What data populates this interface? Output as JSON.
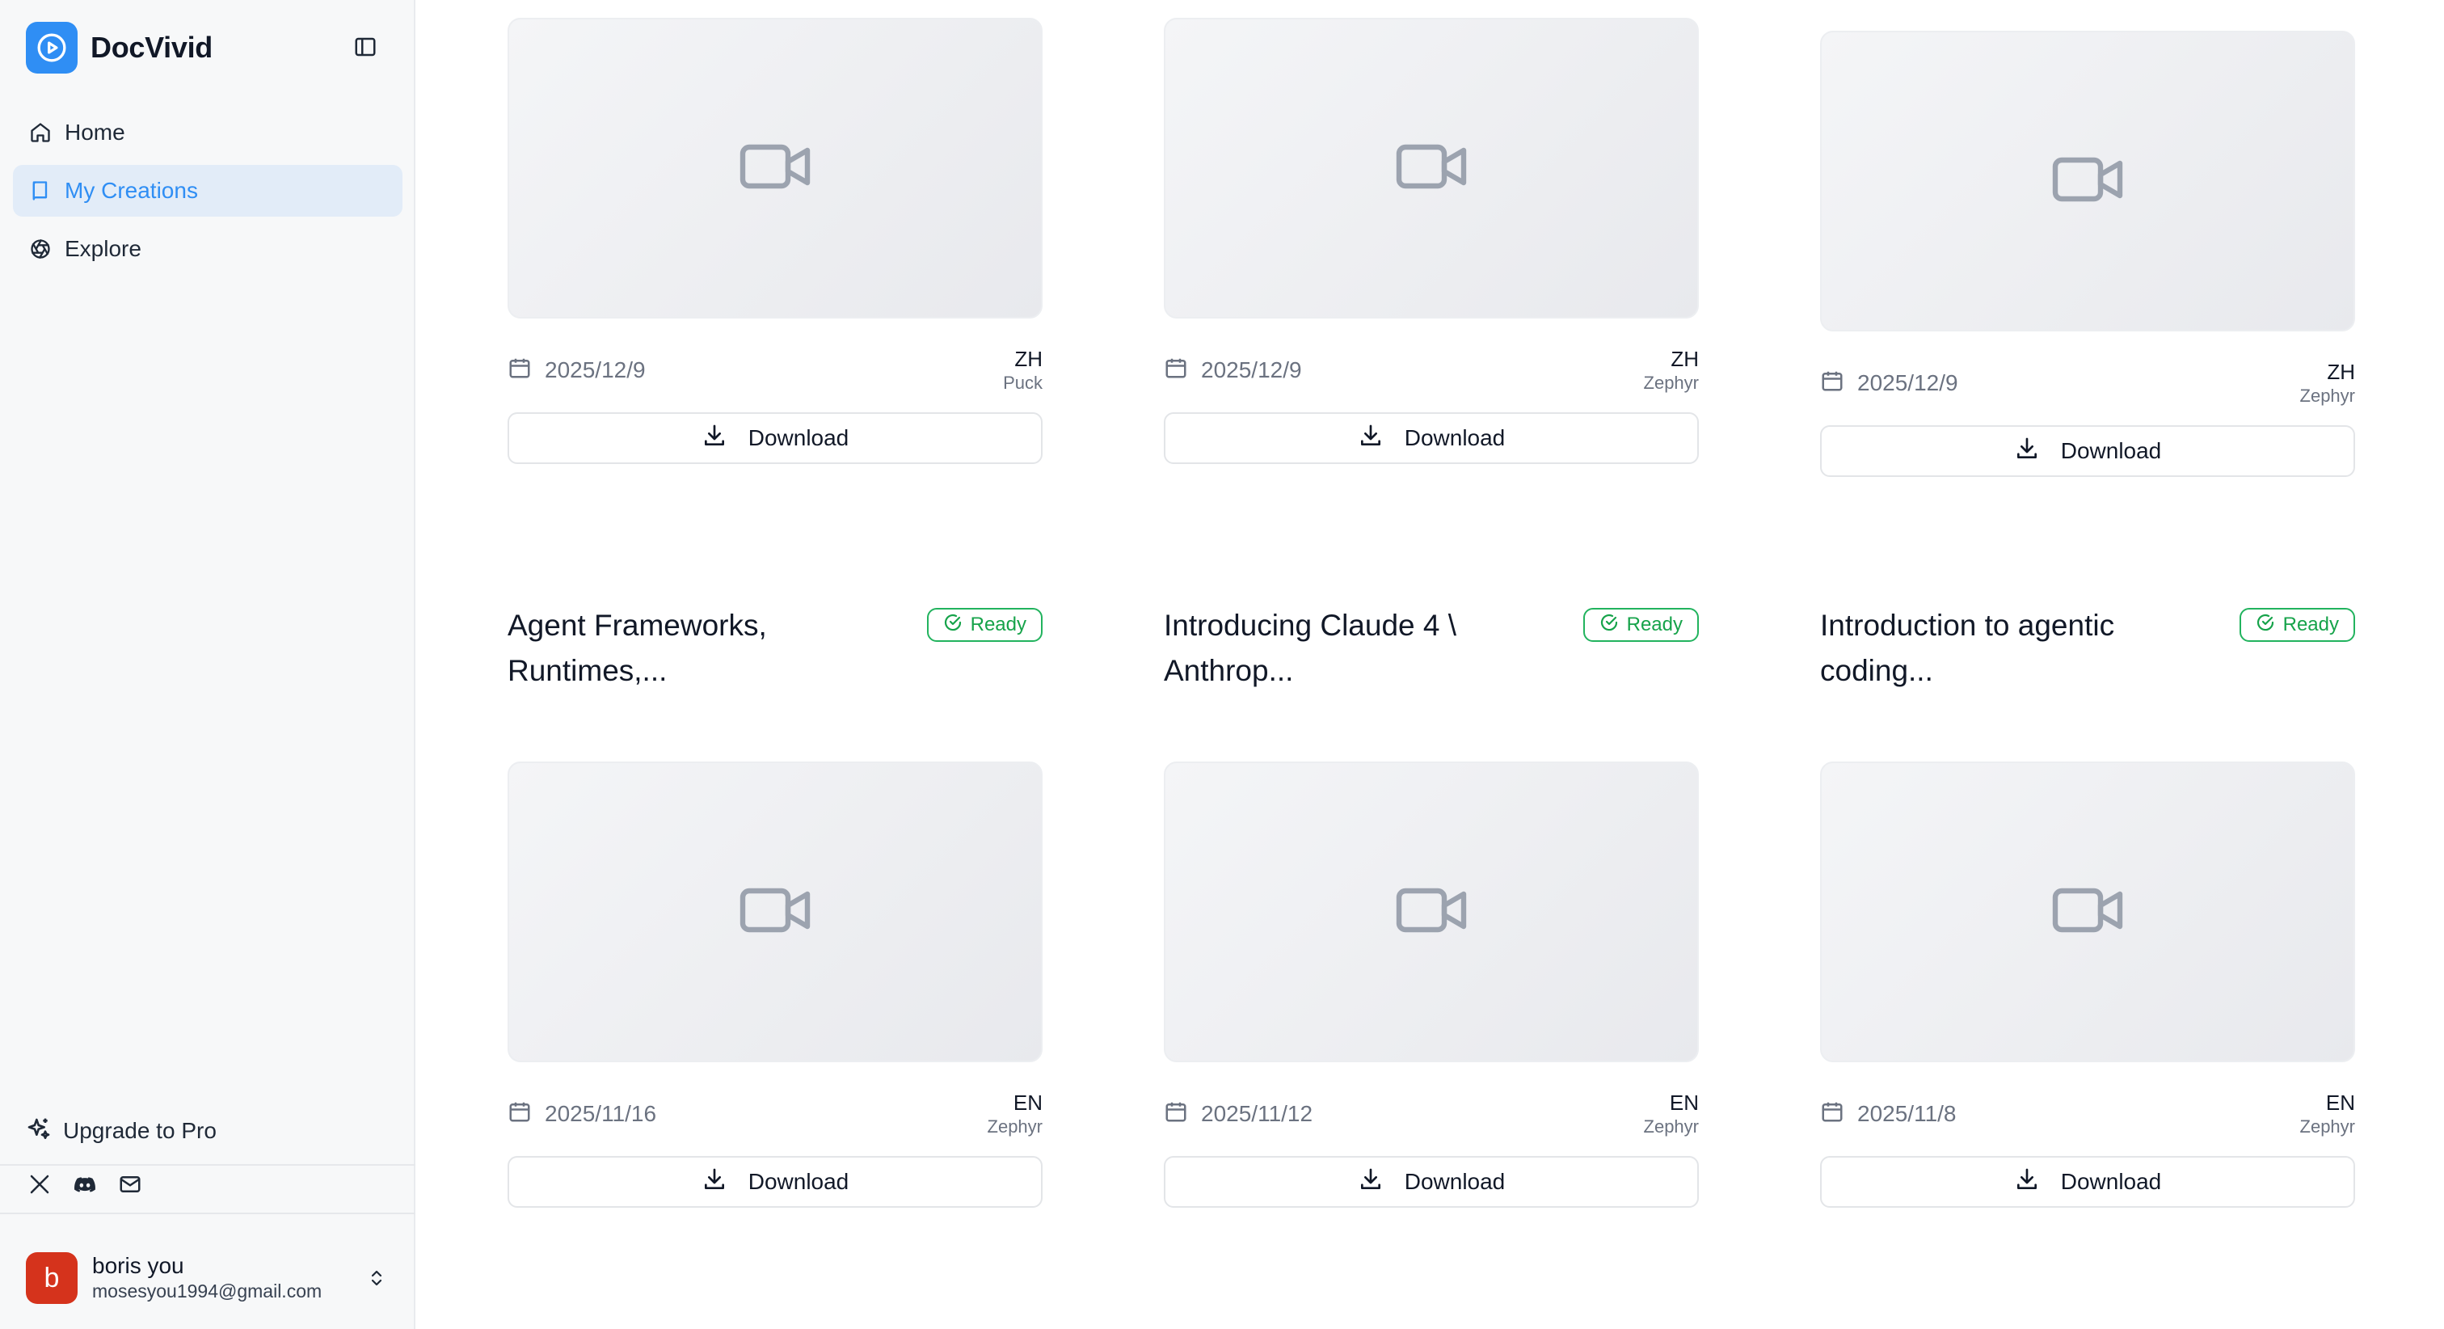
{
  "app": {
    "name": "DocVivid"
  },
  "nav": {
    "items": [
      {
        "label": "Home",
        "icon": "home-icon"
      },
      {
        "label": "My Creations",
        "icon": "book-icon",
        "active": true
      },
      {
        "label": "Explore",
        "icon": "aperture-icon"
      }
    ]
  },
  "upgrade": {
    "label": "Upgrade to Pro",
    "icon": "sparkles-icon"
  },
  "socials": [
    "x-icon",
    "discord-icon",
    "mail-icon"
  ],
  "user": {
    "initial": "b",
    "name": "boris you",
    "email": "mosesyou1994@gmail.com"
  },
  "colors": {
    "accent": "#2f8ef4",
    "ready": "#16a34a",
    "avatar": "#d5331c"
  },
  "download_label": "Download",
  "status_label": "Ready",
  "top_row": [
    {
      "date": "2025/12/9",
      "lang": "ZH",
      "voice": "Puck"
    },
    {
      "date": "2025/12/9",
      "lang": "ZH",
      "voice": "Zephyr"
    },
    {
      "date": "2025/12/9",
      "lang": "ZH",
      "voice": "Zephyr"
    }
  ],
  "cards": [
    {
      "title": "Agent Frameworks, Runtimes,...",
      "status": "Ready",
      "date": "2025/11/16",
      "lang": "EN",
      "voice": "Zephyr"
    },
    {
      "title": "Introducing Claude 4 \\ Anthrop...",
      "status": "Ready",
      "date": "2025/11/12",
      "lang": "EN",
      "voice": "Zephyr"
    },
    {
      "title": "Introduction to agentic coding...",
      "status": "Ready",
      "date": "2025/11/8",
      "lang": "EN",
      "voice": "Zephyr"
    }
  ]
}
